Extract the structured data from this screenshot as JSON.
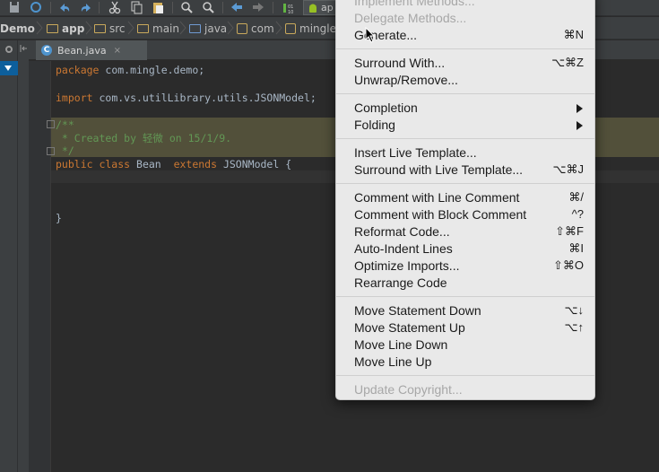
{
  "breadcrumb": [
    {
      "label": "Demo",
      "icon": "module-icon"
    },
    {
      "label": "app",
      "icon": "module-folder-icon"
    },
    {
      "label": "src",
      "icon": "folder-icon"
    },
    {
      "label": "main",
      "icon": "folder-icon"
    },
    {
      "label": "java",
      "icon": "source-folder-icon"
    },
    {
      "label": "com",
      "icon": "package-icon"
    },
    {
      "label": "mingle",
      "icon": "package-icon"
    }
  ],
  "toolbar": {
    "run_config_label": "ap"
  },
  "tab": {
    "label": "Bean.java",
    "type_letter": "C",
    "close": "×"
  },
  "code": {
    "line1_kw": "package",
    "line1_rest": " com.mingle.demo;",
    "line2_kw": "import",
    "line2_rest": " com.vs.utilLibrary.utils.JSONModel;",
    "line3": "/**",
    "line4": " * Created by 轻微 on 15/1/9.",
    "line5": " */",
    "line6_kw1": "public class",
    "line6_name": " Bean  ",
    "line6_kw2": "extends",
    "line6_rest": " JSONModel {",
    "line7": "}"
  },
  "menu": {
    "items": [
      {
        "label": "Implement Methods...",
        "shortcut": "",
        "disabled": true
      },
      {
        "label": "Delegate Methods...",
        "shortcut": "",
        "disabled": true
      },
      {
        "label": "Generate...",
        "shortcut": "⌘N",
        "disabled": false
      },
      {
        "label": "Surround With...",
        "shortcut": "⌥⌘Z",
        "disabled": false
      },
      {
        "label": "Unwrap/Remove...",
        "shortcut": "",
        "disabled": false
      },
      {
        "label": "Completion",
        "shortcut": "",
        "submenu": true
      },
      {
        "label": "Folding",
        "shortcut": "",
        "submenu": true
      },
      {
        "label": "Insert Live Template...",
        "shortcut": ""
      },
      {
        "label": "Surround with Live Template...",
        "shortcut": "⌥⌘J"
      },
      {
        "label": "Comment with Line Comment",
        "shortcut": "⌘/"
      },
      {
        "label": "Comment with Block Comment",
        "shortcut": "^?"
      },
      {
        "label": "Reformat Code...",
        "shortcut": "⇧⌘F"
      },
      {
        "label": "Auto-Indent Lines",
        "shortcut": "⌘I"
      },
      {
        "label": "Optimize Imports...",
        "shortcut": "⇧⌘O"
      },
      {
        "label": "Rearrange Code",
        "shortcut": ""
      },
      {
        "label": "Move Statement Down",
        "shortcut": "⌥↓"
      },
      {
        "label": "Move Statement Up",
        "shortcut": "⌥↑"
      },
      {
        "label": "Move Line Down",
        "shortcut": ""
      },
      {
        "label": "Move Line Up",
        "shortcut": ""
      },
      {
        "label": "Update Copyright...",
        "shortcut": "",
        "disabled": true
      }
    ]
  }
}
